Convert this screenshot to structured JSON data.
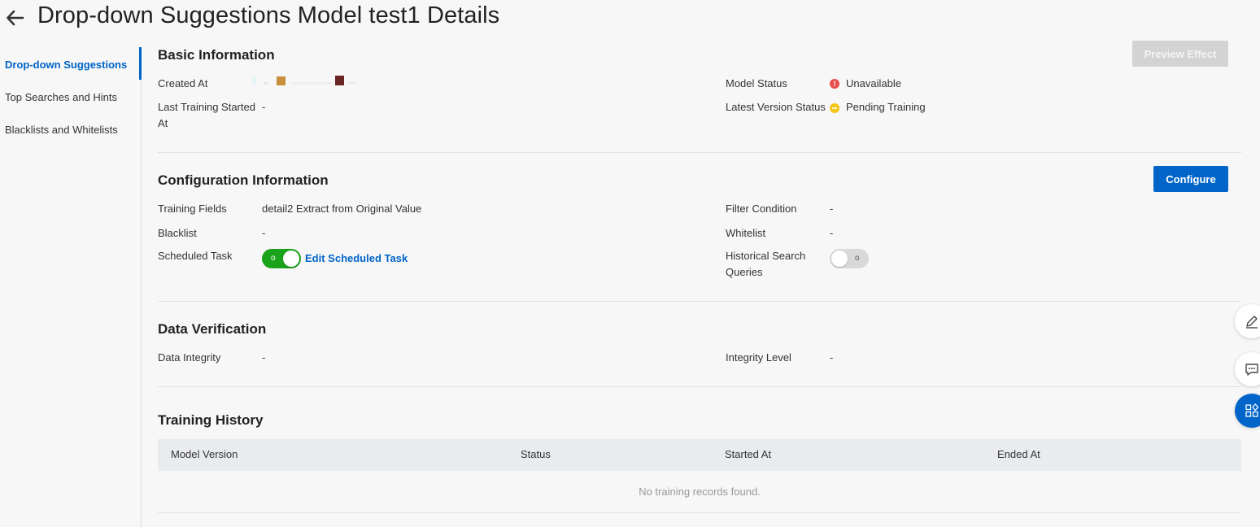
{
  "header": {
    "title": "Drop-down Suggestions Model test1 Details",
    "back_icon": "arrow-left-icon"
  },
  "sidebar": {
    "items": [
      {
        "label": "Drop-down Suggestions",
        "active": true
      },
      {
        "label": "Top Searches and Hints",
        "active": false
      },
      {
        "label": "Blacklists and Whitelists",
        "active": false
      }
    ]
  },
  "basic": {
    "title": "Basic Information",
    "preview_button": "Preview Effect",
    "created_at_label": "Created At",
    "last_training_label_1": "Last Training Started",
    "last_training_label_2": "At",
    "last_training_value": "-",
    "model_status_label": "Model Status",
    "model_status_value": "Unavailable",
    "model_status_icon": "exclamation-circle-icon",
    "model_status_color": "#e84e4e",
    "latest_version_label": "Latest Version Status",
    "latest_version_value": "Pending Training",
    "latest_version_icon": "minus-circle-icon",
    "latest_version_color": "#f5c518"
  },
  "config": {
    "title": "Configuration Information",
    "configure_button": "Configure",
    "training_fields_label": "Training Fields",
    "training_fields_value": "detail2 Extract from Original Value",
    "filter_condition_label": "Filter Condition",
    "filter_condition_value": "-",
    "blacklist_label": "Blacklist",
    "blacklist_value": "-",
    "whitelist_label": "Whitelist",
    "whitelist_value": "-",
    "scheduled_task_label": "Scheduled Task",
    "scheduled_task_on": true,
    "scheduled_task_toggle_text": "o",
    "edit_scheduled_link": "Edit Scheduled Task",
    "historical_label_1": "Historical Search",
    "historical_label_2": "Queries",
    "historical_on": false,
    "historical_toggle_text": "o"
  },
  "verification": {
    "title": "Data Verification",
    "integrity_label": "Data Integrity",
    "integrity_value": "-",
    "level_label": "Integrity Level",
    "level_value": "-"
  },
  "history": {
    "title": "Training History",
    "columns": [
      "Model Version",
      "Status",
      "Started At",
      "Ended At"
    ],
    "empty_text": "No training records found."
  },
  "floating": {
    "edit_icon": "pencil-icon",
    "feedback_icon": "chat-icon",
    "apps_icon": "apps-grid-icon"
  },
  "colors": {
    "accent": "#0064c8",
    "toggle_on": "#1aa31a",
    "toggle_off": "#d9d9d9"
  }
}
